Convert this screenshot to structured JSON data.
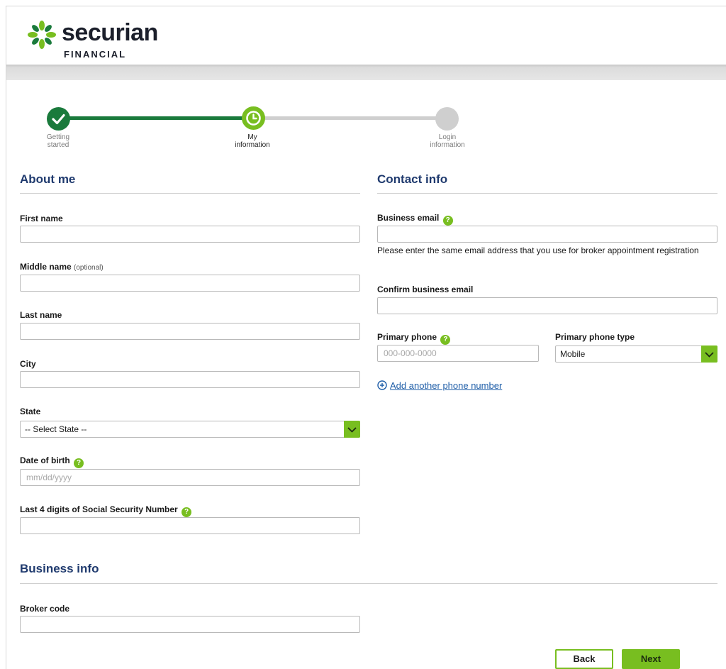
{
  "brand": {
    "name": "securian",
    "sub": "FINANCIAL",
    "primary_green": "#78be20",
    "dark_green": "#1a7a3c",
    "heading_blue": "#1f3a6e",
    "link_blue": "#1f5ea8"
  },
  "progress": {
    "steps": [
      {
        "label": "Getting started",
        "state": "complete",
        "icon": "check-icon"
      },
      {
        "label": "My information",
        "state": "current",
        "icon": "clock-icon"
      },
      {
        "label": "Login information",
        "state": "pending",
        "icon": ""
      }
    ]
  },
  "about_me": {
    "title": "About me",
    "first_name": {
      "label": "First name",
      "value": ""
    },
    "middle_name": {
      "label": "Middle name",
      "optional": "(optional)",
      "value": ""
    },
    "last_name": {
      "label": "Last name",
      "value": ""
    },
    "city": {
      "label": "City",
      "value": ""
    },
    "state": {
      "label": "State",
      "selected": "-- Select State --"
    },
    "dob": {
      "label": "Date of birth",
      "placeholder": "mm/dd/yyyy",
      "value": ""
    },
    "ssn4": {
      "label": "Last 4 digits of Social Security Number",
      "value": ""
    }
  },
  "contact_info": {
    "title": "Contact info",
    "business_email": {
      "label": "Business email",
      "value": ""
    },
    "email_hint": "Please enter the same email address that you use for broker appointment registration",
    "confirm_email": {
      "label": "Confirm business email",
      "value": ""
    },
    "primary_phone": {
      "label": "Primary phone",
      "placeholder": "000-000-0000",
      "value": ""
    },
    "phone_type": {
      "label": "Primary phone type",
      "selected": "Mobile"
    },
    "add_phone_link": "Add another phone number"
  },
  "business_info": {
    "title": "Business info",
    "broker_code": {
      "label": "Broker code",
      "value": ""
    }
  },
  "actions": {
    "back_label": "Back",
    "next_label": "Next"
  }
}
